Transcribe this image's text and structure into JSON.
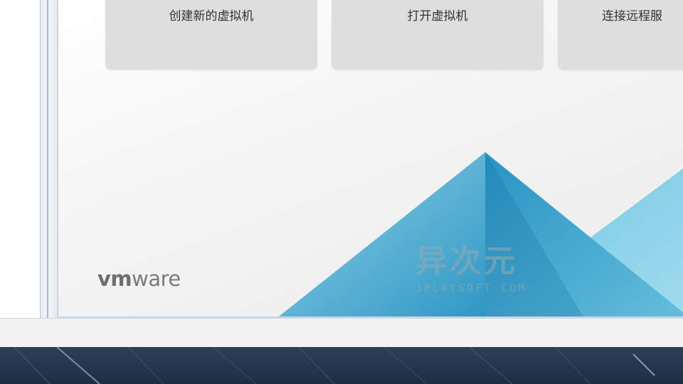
{
  "home": {
    "tiles": [
      {
        "id": "create",
        "label": "创建新的虚拟机"
      },
      {
        "id": "open",
        "label": "打开虚拟机"
      },
      {
        "id": "remote",
        "label": "连接远程服"
      }
    ],
    "logo": {
      "vm": "vm",
      "ware": "ware"
    },
    "watermark": {
      "cn": "异次元",
      "en": "IPLAYSOFT.COM"
    }
  },
  "colors": {
    "tile_bg": "#dedede",
    "mountain_light": "#7fcbe3",
    "mountain_mid": "#4fb0d3",
    "mountain_dark": "#2a8fbf",
    "desktop_bg": "#243650"
  }
}
